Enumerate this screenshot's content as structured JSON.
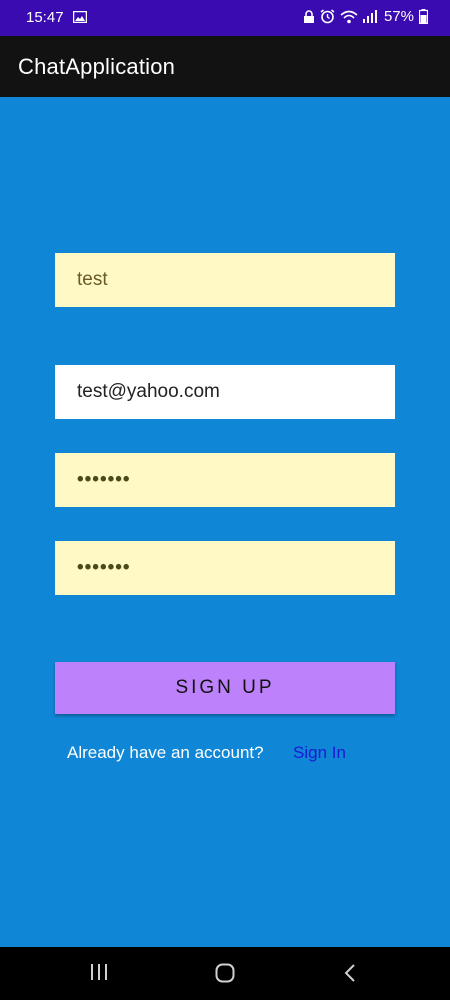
{
  "status_bar": {
    "time": "15:47",
    "battery": "57%",
    "icons": [
      "image-icon",
      "lock-icon",
      "alarm-icon",
      "wifi-icon",
      "signal-icon",
      "battery-icon"
    ]
  },
  "app_bar": {
    "title": "ChatApplication"
  },
  "form": {
    "username": "test",
    "email": "test@yahoo.com",
    "password": "•••••••",
    "confirm_password": "•••••••",
    "signup_label": "SIGN UP",
    "already_text": "Already have an account?",
    "signin_label": "Sign In"
  },
  "nav_bar": {
    "icons": [
      "recent-apps-icon",
      "home-icon",
      "back-icon"
    ]
  },
  "colors": {
    "background": "#0f86d6",
    "status_bar": "#3a0bb0",
    "app_bar": "#121212",
    "field_yellow": "#fff9c6",
    "button": "#bd82fb",
    "link": "#1a1ad4"
  }
}
